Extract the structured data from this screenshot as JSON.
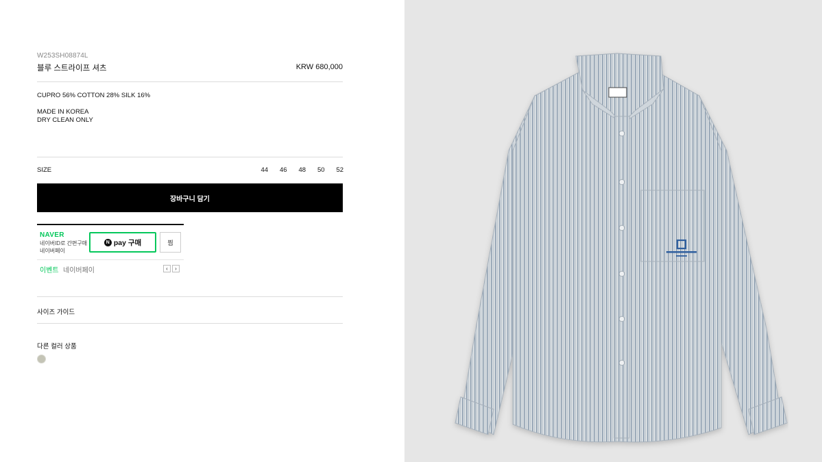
{
  "product": {
    "sku": "W253SH08874L",
    "name": "블루 스트라이프 셔츠",
    "price": "KRW 680,000",
    "composition": "CUPRO 56% COTTON 28% SILK 16%",
    "origin_line1": "MADE IN KOREA",
    "origin_line2": "DRY CLEAN ONLY"
  },
  "size": {
    "label": "SIZE",
    "options": [
      "44",
      "46",
      "48",
      "50",
      "52"
    ]
  },
  "cart_button_label": "장바구니 담기",
  "naver": {
    "brand": "NAVER",
    "desc_line1": "네이버ID로 간편구매",
    "desc_line2": "네이버페이",
    "npay_badge": "N",
    "npay_label": "pay 구매",
    "wish_label": "찜",
    "event_label": "이벤트",
    "event_sub": "네이버페이",
    "prev_arrow": "‹",
    "next_arrow": "›"
  },
  "size_guide_label": "사이즈 가이드",
  "other_colors_label": "다른 컬러 상품",
  "colors": {
    "swatch": "#c4c4b6",
    "naver_green": "#03c75a",
    "cart_bg": "#000000",
    "image_bg": "#e6e6e6"
  }
}
